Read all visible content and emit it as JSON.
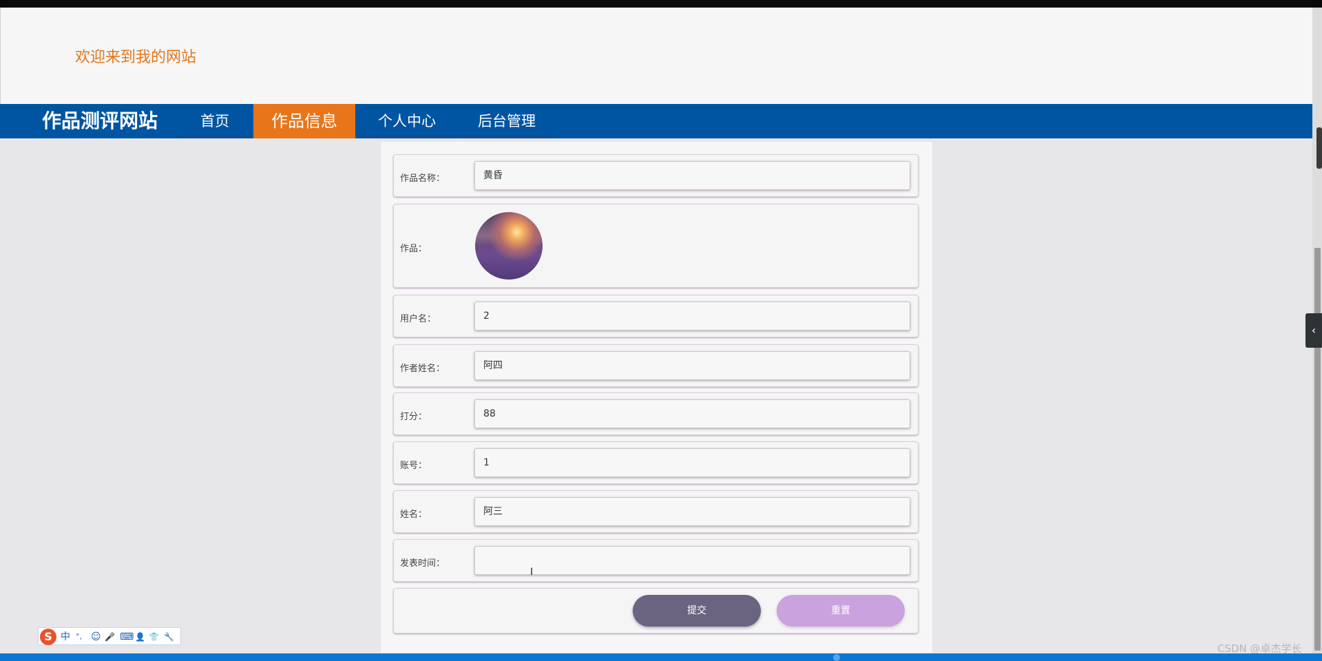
{
  "header": {
    "welcome_text": "欢迎来到我的网站"
  },
  "navbar": {
    "brand": "作品测评网站",
    "items": [
      {
        "label": "首页",
        "active": false
      },
      {
        "label": "作品信息",
        "active": true
      },
      {
        "label": "个人中心",
        "active": false
      },
      {
        "label": "后台管理",
        "active": false
      }
    ]
  },
  "form": {
    "fields": [
      {
        "label": "作品名称：",
        "value": "黄昏"
      },
      {
        "label": "作品：",
        "image": "lavender-field-sunset"
      },
      {
        "label": "用户名：",
        "value": "2"
      },
      {
        "label": "作者姓名：",
        "value": "阿四"
      },
      {
        "label": "打分：",
        "value": "88"
      },
      {
        "label": "账号：",
        "value": "1"
      },
      {
        "label": "姓名：",
        "value": "阿三"
      },
      {
        "label": "发表时间：",
        "value": ""
      }
    ],
    "submit_label": "提交",
    "reset_label": "重置",
    "colors": {
      "submit": "#6b6481",
      "reset": "#c9a2de"
    }
  },
  "side_tab": {
    "icon": "chevron-left-icon",
    "glyph": "‹"
  },
  "ime": {
    "logo": "S",
    "lang": "中",
    "punct": "°,",
    "emoji": "☺",
    "voice": "🎤",
    "keyboard": "⌨",
    "user": "👤",
    "skin": "👕",
    "tools": "🔧"
  },
  "watermark": "CSDN @卓杰学长",
  "colors": {
    "nav": "#0055a2",
    "accent": "#e8751a",
    "welcome": "#e2761a"
  }
}
